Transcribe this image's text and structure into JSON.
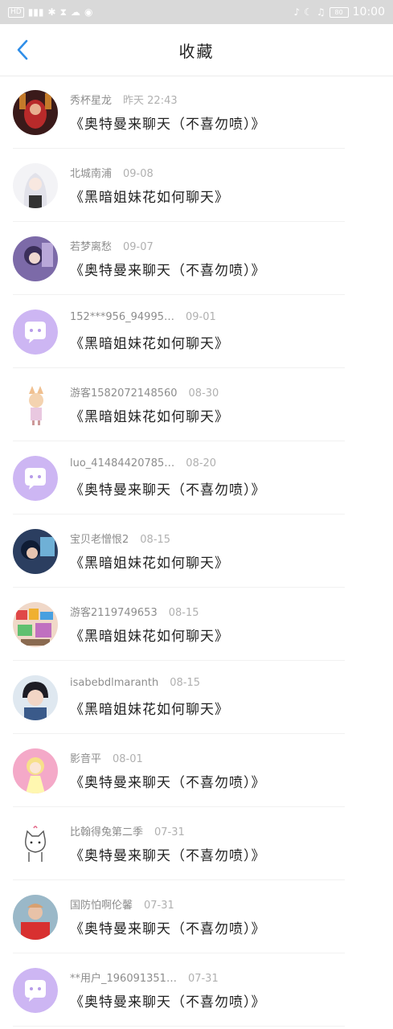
{
  "status_bar": {
    "left_icons": [
      "hd-icon",
      "signal-icon",
      "bluetooth-icon",
      "hourglass-icon",
      "cloud-icon",
      "app-icon"
    ],
    "battery": "80",
    "time": "10:00"
  },
  "header": {
    "title": "收藏"
  },
  "favorites": [
    {
      "name": "秀杯星龙",
      "time": "昨天 22:43",
      "title": "《奥特曼来聊天（不喜勿喷）》",
      "avatar": "photo-red-dark"
    },
    {
      "name": "北城南浦",
      "time": "09-08",
      "title": "《黑暗姐妹花如何聊天》",
      "avatar": "anime-white"
    },
    {
      "name": "若梦离愁",
      "time": "09-07",
      "title": "《奥特曼来聊天（不喜勿喷）》",
      "avatar": "anime-purple"
    },
    {
      "name": "152***956_94995…",
      "time": "09-01",
      "title": "《黑暗姐妹花如何聊天》",
      "avatar": "default"
    },
    {
      "name": "游客1582072148560",
      "time": "08-30",
      "title": "《黑暗姐妹花如何聊天》",
      "avatar": "anime-fox"
    },
    {
      "name": "luo_41484420785…",
      "time": "08-20",
      "title": "《奥特曼来聊天（不喜勿喷）》",
      "avatar": "default"
    },
    {
      "name": "宝贝老憎恨2",
      "time": "08-15",
      "title": "《黑暗姐妹花如何聊天》",
      "avatar": "photo-blue"
    },
    {
      "name": "游客2119749653",
      "time": "08-15",
      "title": "《黑暗姐妹花如何聊天》",
      "avatar": "photo-colorful"
    },
    {
      "name": "isabebdlmaranth",
      "time": "08-15",
      "title": "《黑暗姐妹花如何聊天》",
      "avatar": "photo-person"
    },
    {
      "name": "影音平",
      "time": "08-01",
      "title": "《奥特曼来聊天（不喜勿喷）》",
      "avatar": "anime-pink"
    },
    {
      "name": "比翰得兔第二季",
      "time": "07-31",
      "title": "《奥特曼来聊天（不喜勿喷）》",
      "avatar": "cat-sketch"
    },
    {
      "name": "国防怕啊伦馨",
      "time": "07-31",
      "title": "《奥特曼来聊天（不喜勿喷）》",
      "avatar": "photo-red"
    },
    {
      "name": "**用户_196091351…",
      "time": "07-31",
      "title": "《奥特曼来聊天（不喜勿喷）》",
      "avatar": "default"
    }
  ],
  "colors": {
    "accent": "#2f8ee8",
    "default_avatar_bg": "#cdb6f3",
    "status_bar_bg": "#d9d9d9"
  }
}
